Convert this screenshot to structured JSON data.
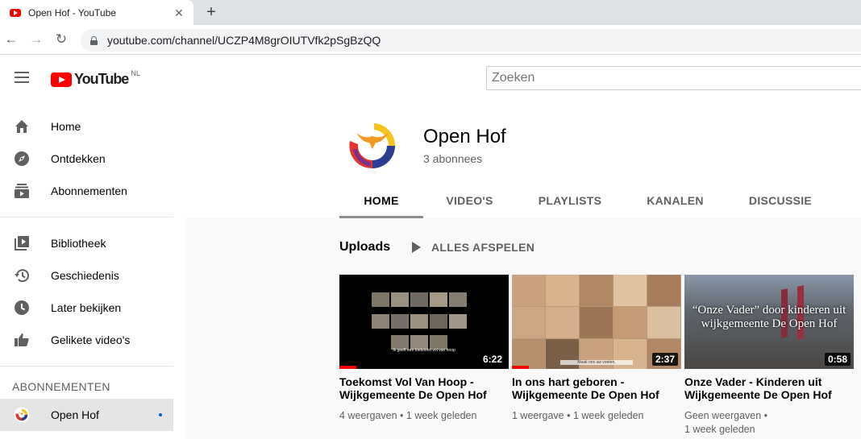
{
  "browser": {
    "tab_title": "Open Hof - YouTube",
    "url": "youtube.com/channel/UCZP4M8grOIUTVfk2pSgBzQQ"
  },
  "masthead": {
    "logo_text": "YouTube",
    "country": "NL",
    "search_placeholder": "Zoeken"
  },
  "sidebar": {
    "items": [
      {
        "label": "Home",
        "icon": "home-icon"
      },
      {
        "label": "Ontdekken",
        "icon": "compass-icon"
      },
      {
        "label": "Abonnementen",
        "icon": "subscriptions-icon"
      },
      {
        "label": "Bibliotheek",
        "icon": "library-icon"
      },
      {
        "label": "Geschiedenis",
        "icon": "history-icon"
      },
      {
        "label": "Later bekijken",
        "icon": "clock-icon"
      },
      {
        "label": "Gelikete video's",
        "icon": "thumbs-up-icon"
      }
    ],
    "section_title": "ABONNEMENTEN",
    "subscriptions": [
      {
        "label": "Open Hof"
      }
    ]
  },
  "channel": {
    "name": "Open Hof",
    "subscribers": "3 abonnees",
    "tabs": [
      "HOME",
      "VIDEO'S",
      "PLAYLISTS",
      "KANALEN",
      "DISCUSSIE"
    ]
  },
  "uploads": {
    "title": "Uploads",
    "play_all": "ALLES AFSPELEN",
    "videos": [
      {
        "title": "Toekomst Vol Van Hoop - Wijkgemeente De Open Hof",
        "meta": "4 weergaven • 1 week geleden",
        "duration": "6:22",
        "caption": "Ik geeft een toekomst vol van hoop",
        "progress": 0.1
      },
      {
        "title": "In ons hart geboren - Wijkgemeente De Open Hof",
        "meta": "1 weergave • 1 week geleden",
        "duration": "2:37",
        "caption": "Maak ons uw voeten,",
        "progress": 0.1
      },
      {
        "title": "Onze Vader - Kinderen uit Wijkgemeente De Open Hof",
        "meta": "Geen weergaven •\n1 week geleden",
        "duration": "0:58",
        "overlay_text": "“Onze Vader” door kinderen uit wijkgemeente De Open Hof"
      }
    ]
  },
  "colors": {
    "brand_red": "#ff0000",
    "text_secondary": "#606060",
    "link_blue": "#065fd4"
  }
}
